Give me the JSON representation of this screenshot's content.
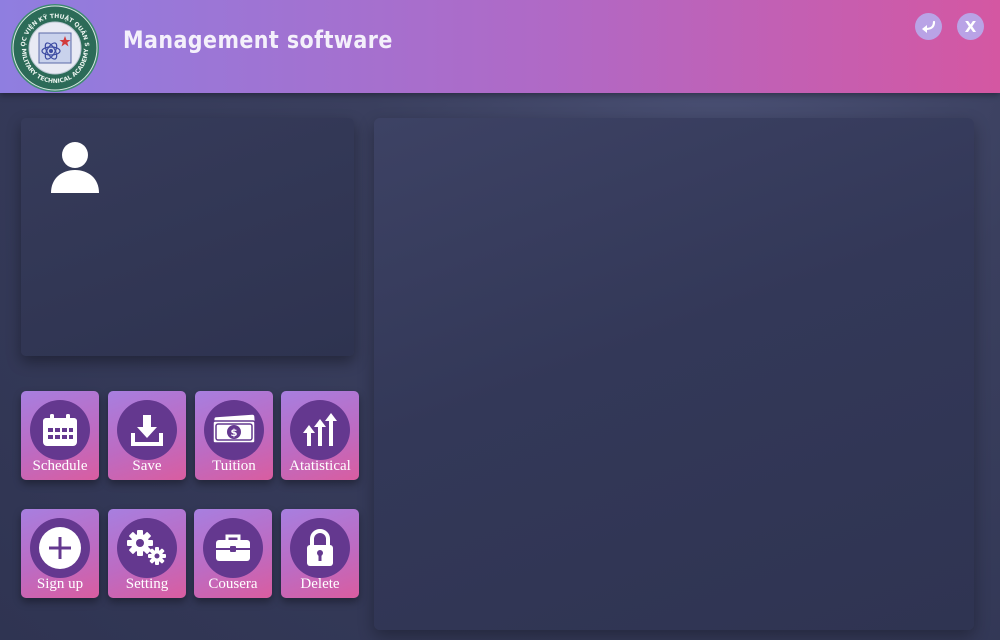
{
  "window": {
    "title": "Management software",
    "logo_text_top": "HỌC VIỆN KỸ THUẬT QUÂN SỰ",
    "logo_text_bottom": "MILITARY TECHNICAL ACADEMY",
    "back_icon": "back-arrow-icon",
    "close_label": "X"
  },
  "colors": {
    "header_gradient": [
      "#8f7ee0",
      "#d457a2"
    ],
    "tile_gradient": [
      "#a77fe0",
      "#d95da0"
    ],
    "icon_circle": "#64388f",
    "background": "#2f3452"
  },
  "profile": {
    "icon": "user-icon"
  },
  "menu": [
    {
      "label": "Schedule",
      "icon": "calendar-icon"
    },
    {
      "label": "Save",
      "icon": "download-icon"
    },
    {
      "label": "Tuition",
      "icon": "money-icon"
    },
    {
      "label": "Atatistical",
      "icon": "chart-arrows-icon"
    },
    {
      "label": "Sign up",
      "icon": "plus-icon"
    },
    {
      "label": "Setting",
      "icon": "gears-icon"
    },
    {
      "label": "Cousera",
      "icon": "briefcase-icon"
    },
    {
      "label": "Delete",
      "icon": "lock-icon"
    }
  ]
}
